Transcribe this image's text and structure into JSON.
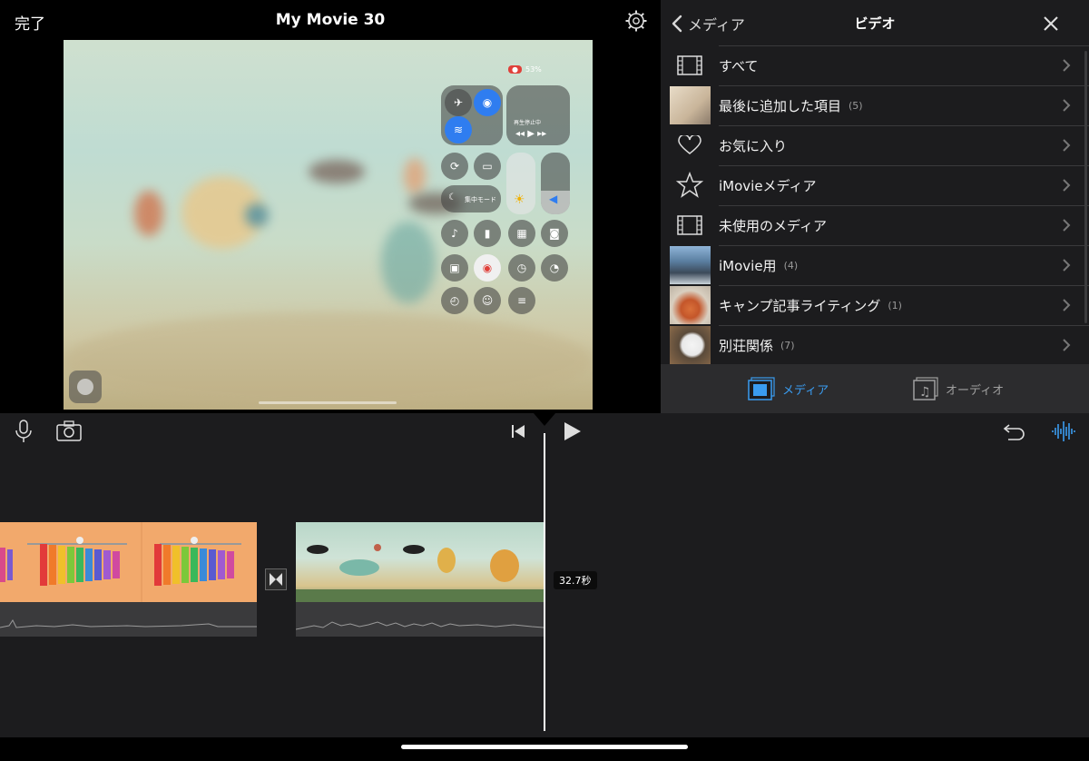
{
  "viewer": {
    "done_label": "完了",
    "title": "My Movie 30",
    "preview": {
      "status_battery": "53%",
      "focus_label": "集中モード",
      "now_playing": "再生停止中"
    }
  },
  "media_panel": {
    "back_label": "メディア",
    "title": "ビデオ",
    "items": [
      {
        "label": "すべて",
        "count": "",
        "icon": "film-icon"
      },
      {
        "label": "最後に追加した項目",
        "count": "(5)",
        "icon": "thumbnail"
      },
      {
        "label": "お気に入り",
        "count": "",
        "icon": "heart-icon"
      },
      {
        "label": "iMovieメディア",
        "count": "",
        "icon": "star-icon"
      },
      {
        "label": "未使用のメディア",
        "count": "",
        "icon": "film-icon"
      },
      {
        "label": "iMovie用",
        "count": "(4)",
        "icon": "thumbnail"
      },
      {
        "label": "キャンプ記事ライティング",
        "count": "(1)",
        "icon": "thumbnail"
      },
      {
        "label": "別荘関係",
        "count": "(7)",
        "icon": "thumbnail"
      }
    ],
    "tabs": {
      "media": "メディア",
      "audio": "オーディオ"
    },
    "accent": "#3a9cf0"
  },
  "timeline": {
    "duration_label": "32.7秒"
  }
}
